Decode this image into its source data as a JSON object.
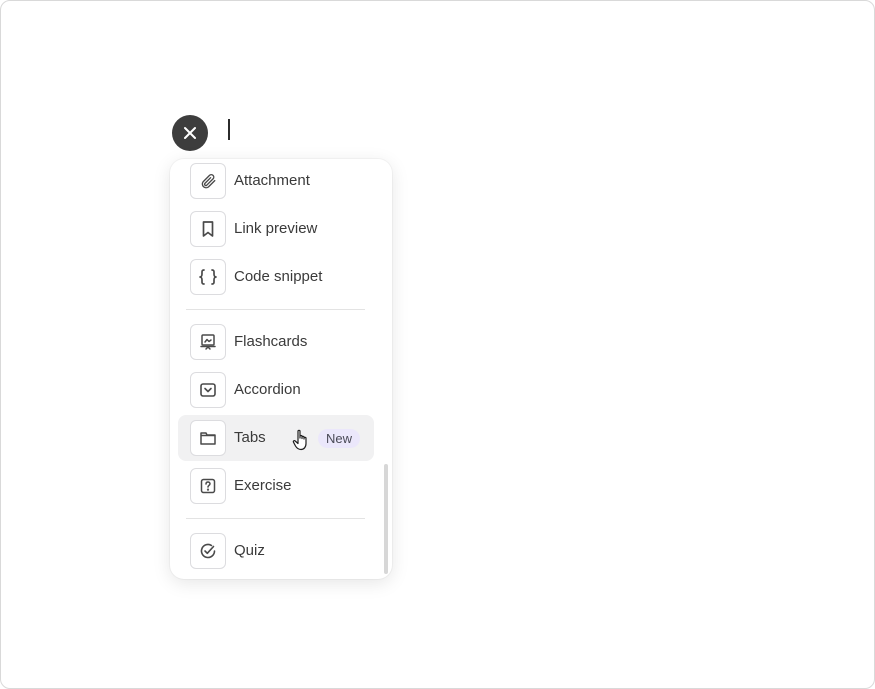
{
  "editor": {
    "close_icon": "close-icon"
  },
  "menu": {
    "items": [
      {
        "label": "Attachment",
        "icon": "paperclip-icon"
      },
      {
        "label": "Link preview",
        "icon": "bookmark-icon"
      },
      {
        "label": "Code snippet",
        "icon": "braces-icon"
      },
      {
        "label": "Flashcards",
        "icon": "flashcards-icon"
      },
      {
        "label": "Accordion",
        "icon": "accordion-icon"
      },
      {
        "label": "Tabs",
        "icon": "tabs-icon",
        "badge": "New",
        "hovered": true
      },
      {
        "label": "Exercise",
        "icon": "question-icon"
      },
      {
        "label": "Quiz",
        "icon": "check-circle-icon"
      }
    ]
  },
  "colors": {
    "close_button": "#3d3d3d",
    "hover_bg": "#f1f1f2",
    "badge_bg": "#ebe7fb",
    "icon_stroke": "#4a4a4a"
  }
}
